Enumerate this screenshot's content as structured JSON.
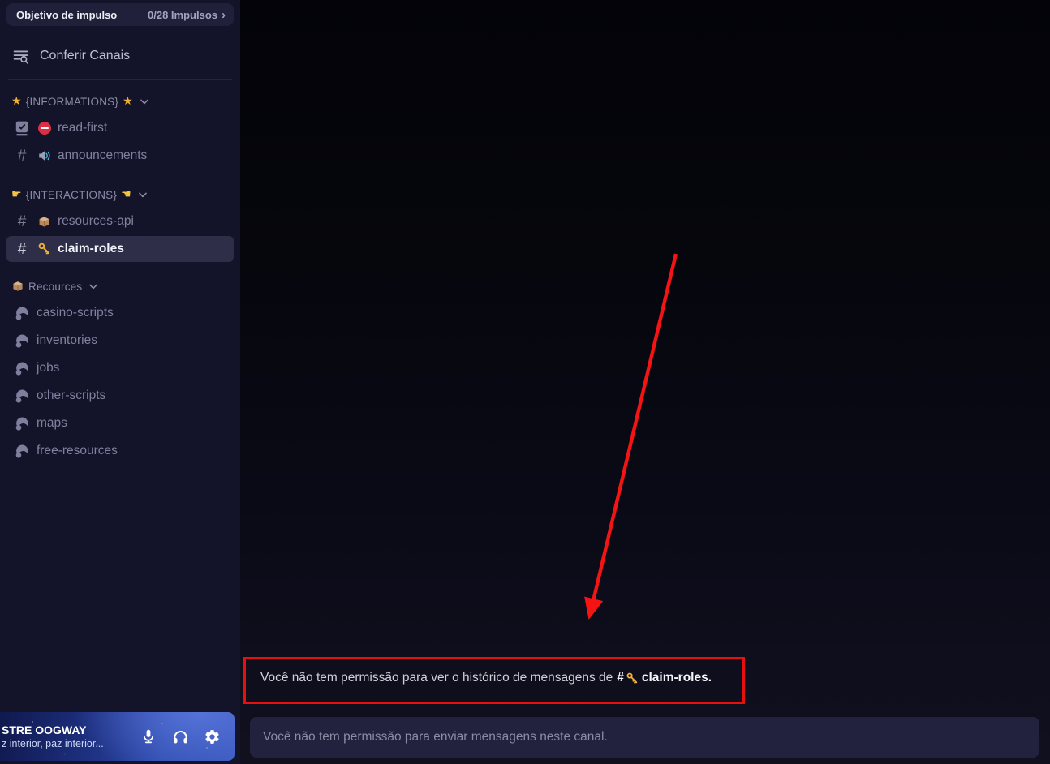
{
  "sidebar": {
    "boost": {
      "title": "Objetivo de impulso",
      "progress": "0/28 Impulsos",
      "chevron": "›"
    },
    "browse_label": "Conferir Canais",
    "categories": [
      {
        "label": "{INFORMATIONS}",
        "prefix_emoji": "star",
        "suffix_emoji": "star",
        "channels": [
          {
            "label": "read-first",
            "icon": "rules-icon",
            "emoji": "no-entry"
          },
          {
            "label": "announcements",
            "icon": "hash-icon",
            "emoji": "speaker"
          }
        ]
      },
      {
        "label": "{INTERACTIONS}",
        "prefix_emoji": "point-right",
        "suffix_emoji": "point-left",
        "channels": [
          {
            "label": "resources-api",
            "icon": "hash-icon",
            "emoji": "package"
          },
          {
            "label": "claim-roles",
            "icon": "hash-icon",
            "emoji": "key",
            "selected": true
          }
        ]
      },
      {
        "label": "Recources",
        "prefix_emoji": "package",
        "channels": [
          {
            "label": "casino-scripts",
            "icon": "forum-icon"
          },
          {
            "label": "inventories",
            "icon": "forum-icon"
          },
          {
            "label": "jobs",
            "icon": "forum-icon"
          },
          {
            "label": "other-scripts",
            "icon": "forum-icon"
          },
          {
            "label": "maps",
            "icon": "forum-icon"
          },
          {
            "label": "free-resources",
            "icon": "forum-icon"
          }
        ]
      }
    ]
  },
  "glyphs": {
    "star": "★",
    "point_right": "☛",
    "point_left": "☚",
    "boost_chevron": "›"
  },
  "user_panel": {
    "username": "STRE OOGWAY",
    "status": "z interior, paz interior...",
    "buttons": [
      "microphone",
      "headphones",
      "settings"
    ]
  },
  "main": {
    "notice": {
      "prefix": "Você não tem permissão para ver o histórico de mensagens de",
      "hash": "#",
      "channel": "claim-roles",
      "suffix": "."
    },
    "composer_placeholder": "Você não tem permissão para enviar mensagens neste canal."
  },
  "colors": {
    "annotation_red": "#e80f0f",
    "selected_channel_bg": "#2e2e49",
    "emoji_gold": "#f0b232",
    "user_panel_blue": "#2f4cae"
  }
}
